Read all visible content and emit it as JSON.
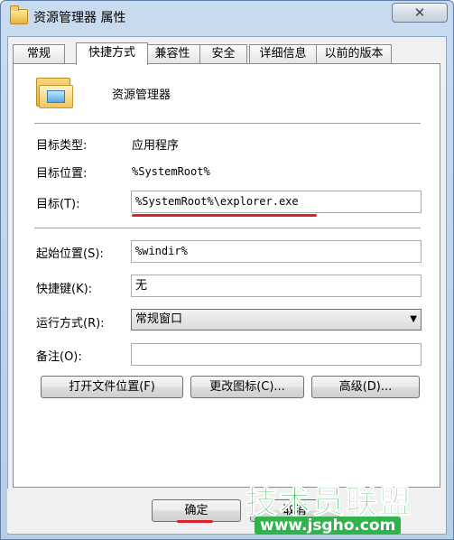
{
  "window": {
    "title": "资源管理器 属性",
    "close_glyph": "✕"
  },
  "tabs": [
    {
      "label": "常规",
      "active": false
    },
    {
      "label": "快捷方式",
      "active": true
    },
    {
      "label": "兼容性",
      "active": false
    },
    {
      "label": "安全",
      "active": false
    },
    {
      "label": "详细信息",
      "active": false
    },
    {
      "label": "以前的版本",
      "active": false
    }
  ],
  "shortcut": {
    "name": "资源管理器",
    "target_type_label": "目标类型:",
    "target_type_value": "应用程序",
    "target_location_label": "目标位置:",
    "target_location_value": "%SystemRoot%",
    "target_label": "目标(T):",
    "target_value": "%SystemRoot%\\explorer.exe",
    "start_in_label": "起始位置(S):",
    "start_in_value": "%windir%",
    "hotkey_label": "快捷键(K):",
    "hotkey_value": "无",
    "run_label": "运行方式(R):",
    "run_value": "常规窗口",
    "comment_label": "备注(O):",
    "comment_value": ""
  },
  "buttons": {
    "open_location": "打开文件位置(F)",
    "change_icon": "更改图标(C)...",
    "advanced": "高级(D)...",
    "ok": "确定",
    "cancel": "取消"
  },
  "icons": {
    "title": "folder-icon",
    "shortcut": "explorer-folder-icon",
    "dropdown": "chevron-down-icon"
  },
  "colors": {
    "highlight": "#d9232a",
    "watermark": "#2fb34a"
  },
  "watermark": {
    "text": "技术员联盟",
    "url": "www.jsgho.com"
  }
}
